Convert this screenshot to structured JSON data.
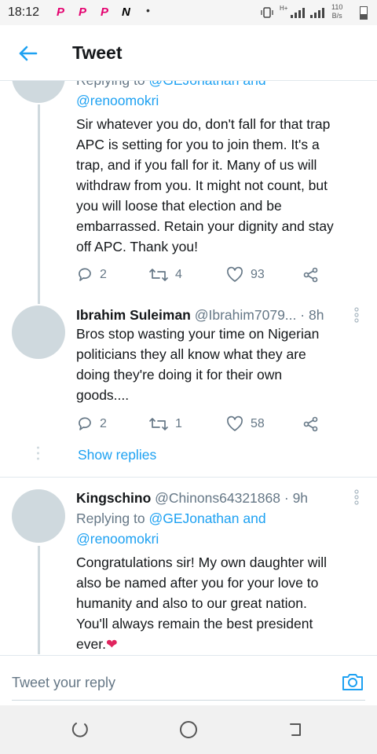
{
  "status_bar": {
    "time": "18:12",
    "app_icons": [
      "P",
      "P",
      "P",
      "N"
    ],
    "dot": "•",
    "signal_text": "H+",
    "speed_value": "110",
    "speed_unit": "B/s"
  },
  "header": {
    "title": "Tweet"
  },
  "tweets": [
    {
      "replying_label": "Replying to",
      "replying_handles_line1": "@GEJonathan and",
      "replying_handles_line2": "@renoomokri",
      "lines": [
        "Sir whatever you do, don't fall for that trap",
        "APC is setting for you to join them. It's a",
        "trap, and if you fall for it. Many of us will",
        "withdraw from you. It might not count, but",
        "you will loose that election and be",
        "embarrassed. Retain your dignity and stay",
        "off APC. Thank you!"
      ],
      "replies": "2",
      "retweets": "4",
      "likes": "93"
    },
    {
      "name": "Ibrahim Suleiman",
      "handle": "@Ibrahim7079...",
      "time": "· 8h",
      "lines": [
        "Bros  stop wasting your time on Nigerian",
        "politicians they all know what they are",
        "doing  they're doing it for their own",
        "goods...."
      ],
      "replies": "2",
      "retweets": "1",
      "likes": "58",
      "show_replies": "Show replies"
    },
    {
      "name": "Kingschino",
      "handle": "@Chinons64321868",
      "time": "· 9h",
      "replying_label": "Replying to",
      "replying_handles_line1": "@GEJonathan and",
      "replying_handles_line2": "@renoomokri",
      "lines": [
        "Congratulations sir! My own daughter will",
        "also be named after you for your love to",
        "humanity and also to our great nation.",
        "You'll always remain the best president",
        "ever."
      ],
      "emoji": "❤"
    }
  ],
  "compose": {
    "placeholder": "Tweet your reply"
  },
  "colors": {
    "accent": "#1da1f2",
    "secondary_text": "#657786",
    "avatar_placeholder": "#cfd9de",
    "heart_emoji": "#e0245e"
  },
  "icons": {
    "back": "arrow-left-icon",
    "reply": "reply-bubble-icon",
    "retweet": "retweet-icon",
    "like": "heart-icon",
    "share": "share-icon",
    "more": "kebab-icon",
    "camera": "camera-icon"
  }
}
